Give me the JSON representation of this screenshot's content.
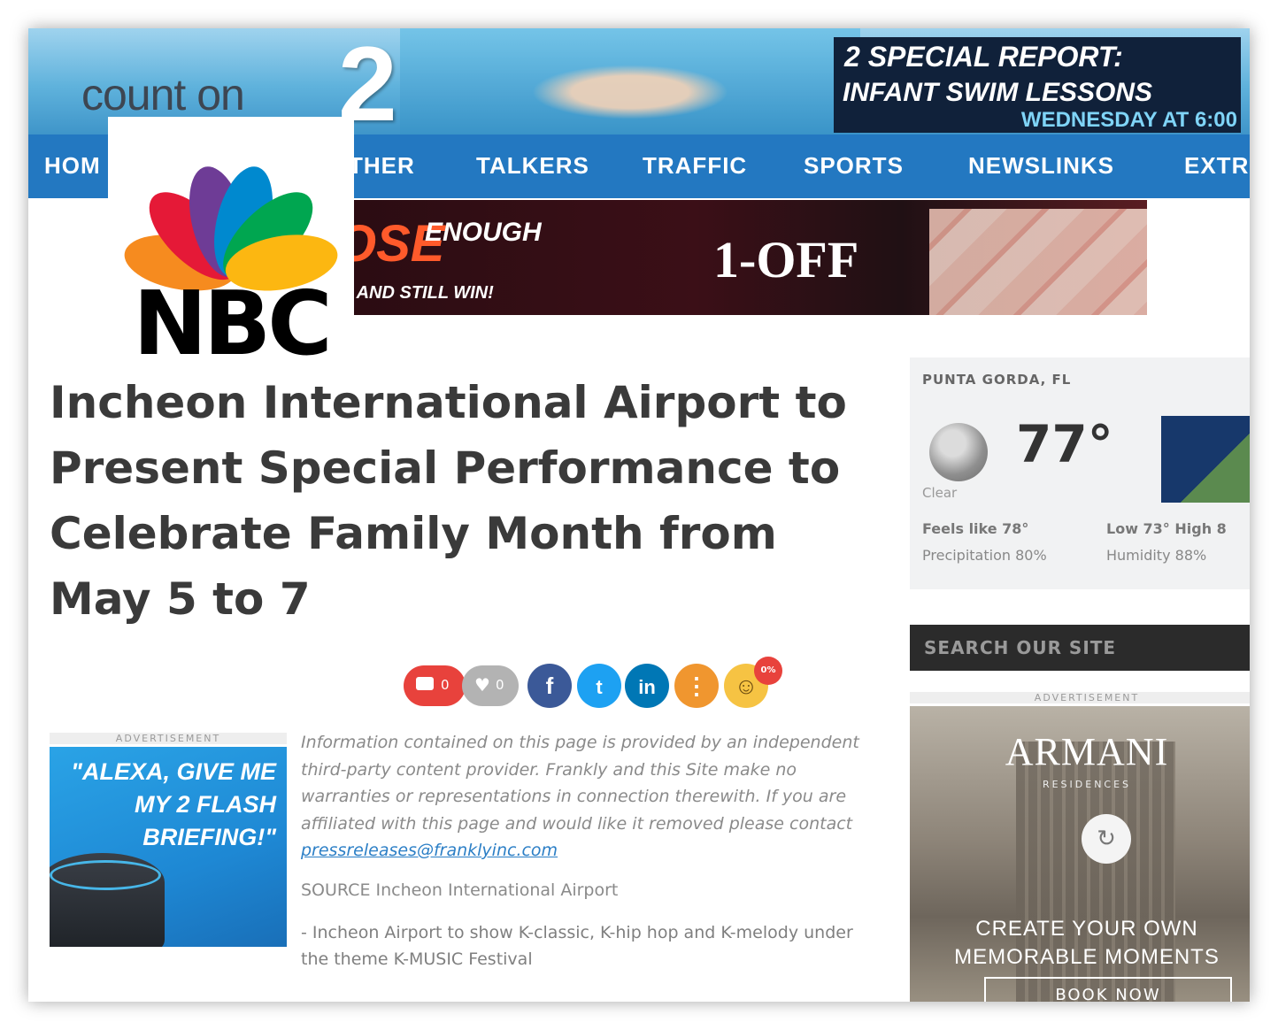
{
  "header": {
    "brand_text": "count on",
    "brand_number": "2",
    "special_report": {
      "line1": "2 SPECIAL REPORT:",
      "line2": "INFANT SWIM LESSONS",
      "line3": "WEDNESDAY AT 6:00"
    }
  },
  "nav": {
    "items": [
      "HOM",
      "THER",
      "TALKERS",
      "TRAFFIC",
      "SPORTS",
      "NEWSLINKS",
      "EXTR"
    ]
  },
  "top_ad": {
    "word1": "OSE",
    "word2": "ENOUGH",
    "tagline": "NE AND STILL WIN!",
    "product": "1-OFF"
  },
  "logo": {
    "name": "NBC",
    "colors": [
      "#f68b1f",
      "#e51937",
      "#6e3c96",
      "#0089cf",
      "#00a650",
      "#fcb711"
    ]
  },
  "article": {
    "headline": "Incheon International Airport to Present Special Performance to Celebrate Family Month from May 5 to 7",
    "disclaimer": "Information contained on this page is provided by an independent third-party content provider. Frankly and this Site make no warranties or representations in connection therewith. If you are affiliated with this page and would like it removed please contact ",
    "contact_email": "pressreleases@franklyinc.com",
    "source": "SOURCE Incheon International Airport",
    "bullet": "- Incheon Airport to show K-classic, K-hip hop and K-melody under the theme K-MUSIC Festival"
  },
  "share": {
    "comments_count": "0",
    "likes_count": "0",
    "reaction_badge": "0%",
    "icons": [
      "comment-icon",
      "heart-icon",
      "facebook-icon",
      "twitter-icon",
      "linkedin-icon",
      "more-icon",
      "emoji-icon"
    ],
    "colors": {
      "comment": "#e8423c",
      "like": "#b3b3b3",
      "facebook": "#3b5998",
      "twitter": "#1da1f2",
      "linkedin": "#0077b5",
      "more": "#f0962f"
    }
  },
  "ads": {
    "label": "ADVERTISEMENT",
    "alexa_text": "\"ALEXA, GIVE ME MY 2 FLASH BRIEFING!\"",
    "armani_brand": "ARMANI",
    "armani_sub": "RESIDENCES",
    "armani_cta": "CREATE YOUR OWN MEMORABLE MOMENTS",
    "armani_button": "BOOK NOW"
  },
  "weather": {
    "location": "PUNTA GORDA, FL",
    "temperature": "77°",
    "condition": "Clear",
    "feels_like": "Feels like 78°",
    "precipitation": "Precipitation 80%",
    "low_high": "Low 73° High 8",
    "humidity": "Humidity 88%"
  },
  "search": {
    "placeholder": "SEARCH OUR SITE"
  }
}
